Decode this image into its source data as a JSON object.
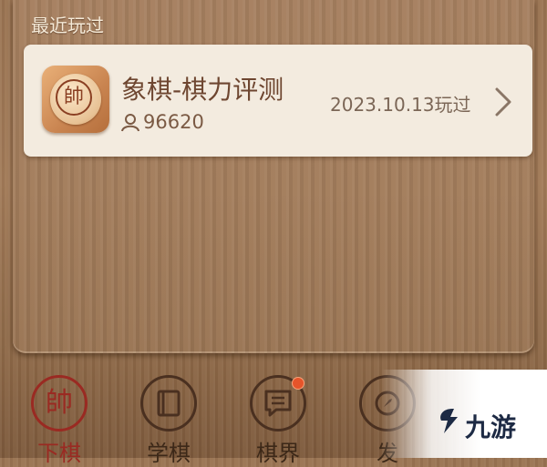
{
  "section": {
    "title": "最近玩过"
  },
  "recent_game": {
    "icon": "chess-shuai-piece-icon",
    "icon_glyph": "帥",
    "title": "象棋-棋力评测",
    "players_icon": "person-icon",
    "players": "96620",
    "last_played": "2023.10.13玩过",
    "chevron": "chevron-right-icon"
  },
  "tabs": [
    {
      "label": "下棋",
      "icon": "shuai-piece-icon",
      "glyph": "帥",
      "active": true
    },
    {
      "label": "学棋",
      "icon": "book-icon",
      "active": false
    },
    {
      "label": "棋界",
      "icon": "chat-news-icon",
      "active": false,
      "badge": true
    },
    {
      "label": "发",
      "icon": "compass-icon",
      "active": false
    }
  ],
  "watermark": {
    "text": "九游",
    "logo": "jiuyou-logo-icon"
  },
  "colors": {
    "card_bg": "#f3ebdf",
    "wood": "#a37d5c",
    "title_text": "#6e4630",
    "active_tab": "#9a2a22",
    "badge": "#e5542a"
  }
}
